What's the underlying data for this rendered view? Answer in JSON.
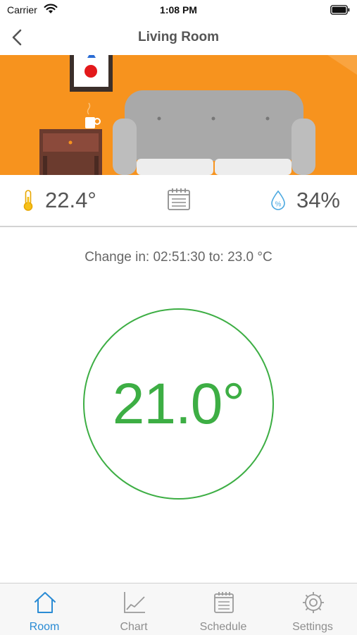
{
  "status_bar": {
    "carrier": "Carrier",
    "time": "1:08 PM"
  },
  "nav": {
    "title": "Living Room",
    "back_icon": "chevron-left-icon"
  },
  "stats": {
    "temperature": "22.4°",
    "humidity": "34%",
    "temperature_icon": "thermometer-icon",
    "schedule_icon": "calendar-icon",
    "humidity_icon": "humidity-drop-icon"
  },
  "change_text": "Change in: 02:51:30 to: 23.0 °C",
  "setpoint": {
    "value": "21.0°",
    "color": "#3DAE44"
  },
  "tabs": [
    {
      "label": "Room",
      "icon": "home-icon",
      "active": true
    },
    {
      "label": "Chart",
      "icon": "chart-icon",
      "active": false
    },
    {
      "label": "Schedule",
      "icon": "calendar-icon",
      "active": false
    },
    {
      "label": "Settings",
      "icon": "gear-icon",
      "active": false
    }
  ],
  "colors": {
    "accent": "#2A8BD4",
    "hero_background": "#F7931E",
    "setpoint": "#3DAE44"
  }
}
